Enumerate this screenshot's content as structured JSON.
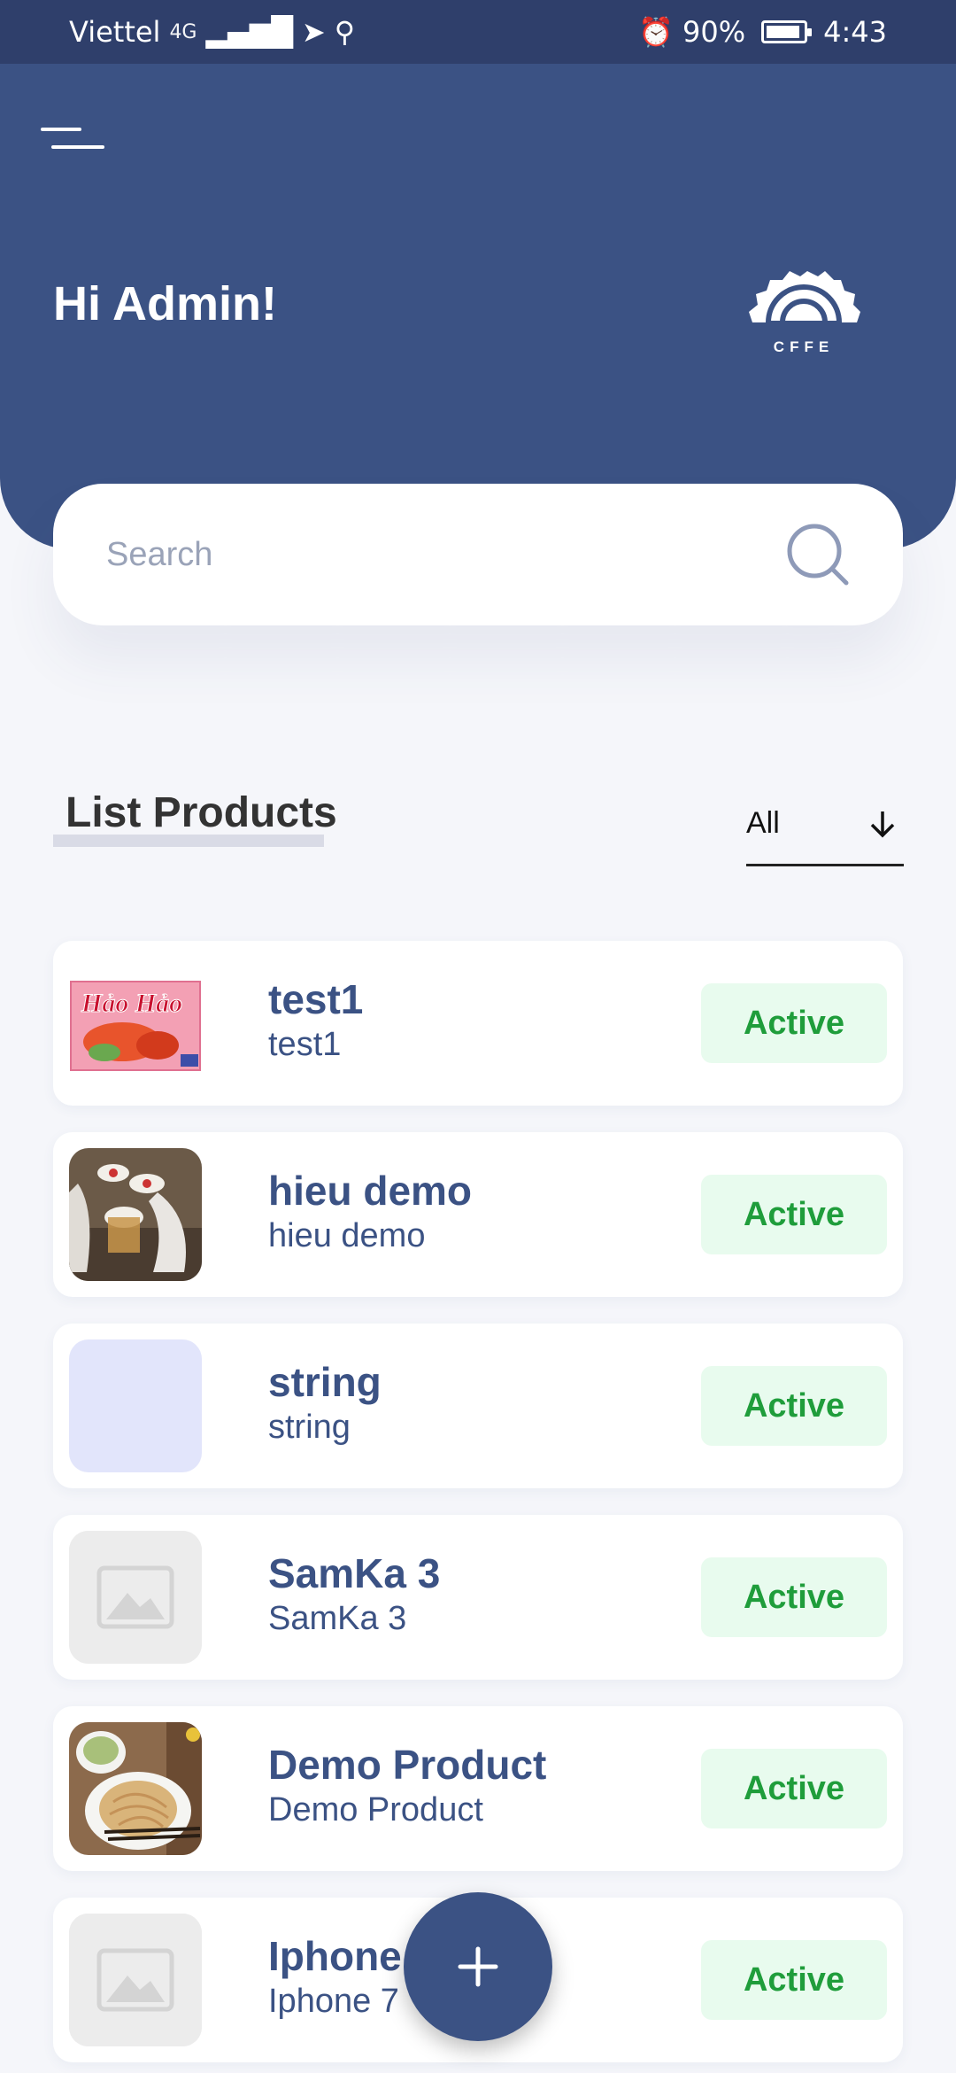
{
  "status_bar": {
    "carrier": "Viettel",
    "network": "4G",
    "battery": "90%",
    "time": "4:43"
  },
  "header": {
    "greeting": "Hi Admin!",
    "logo_text": "CFFE",
    "menu_icon": "menu-icon"
  },
  "search": {
    "placeholder": "Search",
    "value": "",
    "icon": "search-icon"
  },
  "section": {
    "title": "List Products"
  },
  "filter": {
    "selected": "All",
    "icon": "arrow-down-icon"
  },
  "products": [
    {
      "name": "test1",
      "subtitle": "test1",
      "status": "Active",
      "thumb": "noodle-pack-image"
    },
    {
      "name": "hieu demo",
      "subtitle": "hieu demo",
      "status": "Active",
      "thumb": "cups-photo"
    },
    {
      "name": "string",
      "subtitle": "string",
      "status": "Active",
      "thumb": "lavender-placeholder"
    },
    {
      "name": "SamKa 3",
      "subtitle": "SamKa 3",
      "status": "Active",
      "thumb": "image-placeholder-icon"
    },
    {
      "name": "Demo Product",
      "subtitle": "Demo Product",
      "status": "Active",
      "thumb": "noodles-photo"
    },
    {
      "name": "Iphone 7",
      "subtitle": "Iphone 7",
      "status": "Active",
      "thumb": "image-placeholder-icon"
    }
  ],
  "fab": {
    "icon": "plus-icon"
  },
  "colors": {
    "primary": "#3b5284",
    "status_bar": "#2f3f6b",
    "active_text": "#1f9d3b",
    "active_bg": "#e8fbee",
    "background": "#f5f6fa"
  }
}
